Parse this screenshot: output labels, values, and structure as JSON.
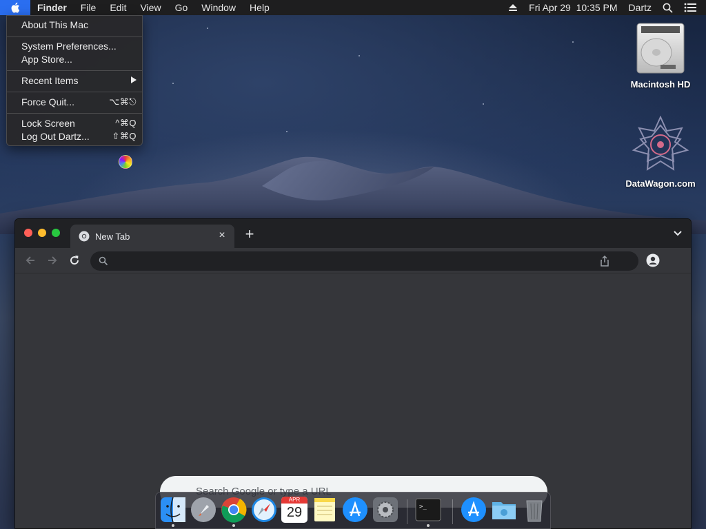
{
  "menubar": {
    "app_name": "Finder",
    "menus": [
      "File",
      "Edit",
      "View",
      "Go",
      "Window",
      "Help"
    ],
    "datetime": "Fri Apr 29  10:35 PM",
    "user": "Dartz"
  },
  "apple_menu": {
    "items": [
      {
        "label": "About This Mac",
        "shortcut": ""
      },
      {
        "label": "System Preferences...",
        "shortcut": ""
      },
      {
        "label": "App Store...",
        "shortcut": ""
      },
      {
        "label": "Recent Items",
        "shortcut": ""
      },
      {
        "label": "Force Quit...",
        "shortcut": "⌥⌘⎋"
      },
      {
        "label": "Lock Screen",
        "shortcut": "^⌘Q"
      },
      {
        "label": "Log Out Dartz...",
        "shortcut": "⇧⌘Q"
      }
    ]
  },
  "desktop_icons": [
    {
      "label": "Macintosh HD",
      "icon": "hard-drive-icon"
    },
    {
      "label": "DataWagon.com",
      "icon": "datawagon-logo-icon"
    }
  ],
  "browser": {
    "tab_title": "New Tab",
    "omnibox_value": "",
    "search_placeholder": "Search Google or type a URL"
  },
  "dock": {
    "calendar_month": "APR",
    "calendar_day": "29",
    "apps": [
      "Finder",
      "Launchpad",
      "Google Chrome",
      "Safari",
      "Calendar",
      "Notes",
      "App Store",
      "System Preferences",
      "Terminal",
      "Applications",
      "Downloads",
      "Trash"
    ]
  },
  "colors": {
    "menubar_bg": "#1e1e1f",
    "apple_highlight": "#2a6ef0",
    "browser_bg": "#35363a",
    "tabstrip_bg": "#202124"
  }
}
